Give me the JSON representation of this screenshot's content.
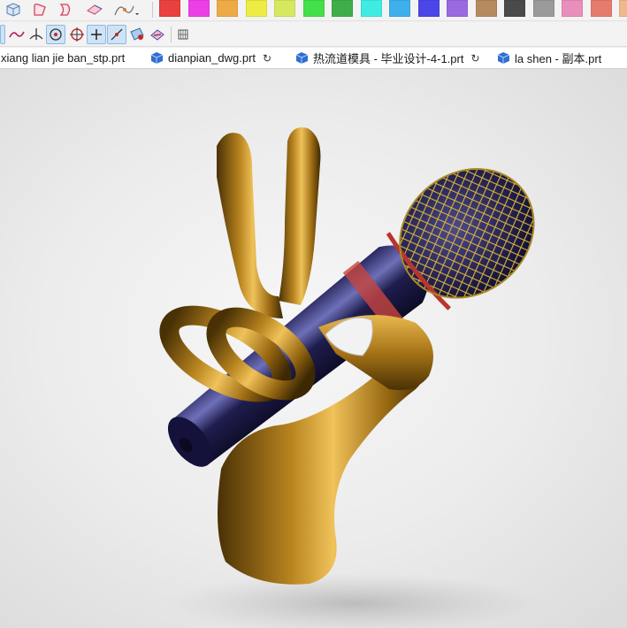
{
  "toolbar": {
    "colors": [
      "#ea4040",
      "#ec3fe6",
      "#eeaa45",
      "#ecec45",
      "#d6e85e",
      "#44e04a",
      "#3fae4a",
      "#3fece3",
      "#3fb0ec",
      "#4b46e8",
      "#9a6ae0",
      "#b58a5f",
      "#4a4a4a",
      "#9a9a9a",
      "#e88fbb",
      "#e57b6d",
      "#f0b98a"
    ],
    "icons": [
      "view-cube-icon",
      "sketch-curve-icon",
      "extrude-shape-icon",
      "surface-icon",
      "curve-edit-icon",
      "spline-icon",
      "normal-axis-icon",
      "circle-center-icon",
      "target-circle-icon",
      "plus-point-icon",
      "line-icon",
      "face-analysis-icon",
      "section-view-icon",
      "grid-icon"
    ]
  },
  "tabs": [
    {
      "label": "xiang lian jie ban_stp.prt"
    },
    {
      "label": "dianpian_dwg.prt"
    },
    {
      "label": "热流道模具 - 毕业设计-4-1.prt"
    },
    {
      "label": "la shen - 副本.prt"
    }
  ]
}
